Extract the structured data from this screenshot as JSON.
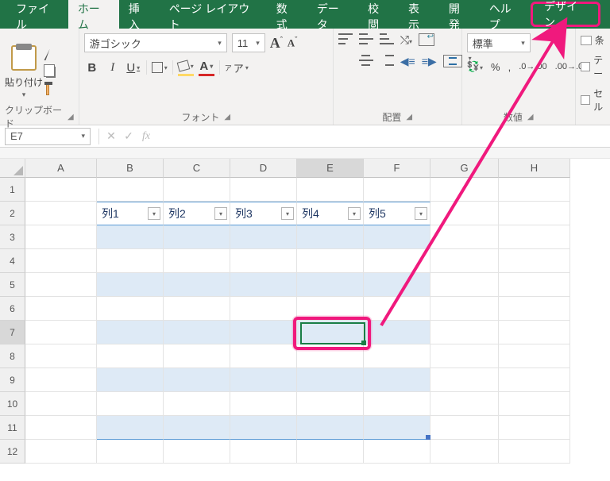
{
  "tabs": {
    "file": "ファイル",
    "home": "ホーム",
    "insert": "挿入",
    "layout": "ページ レイアウト",
    "formulas": "数式",
    "data": "データ",
    "review": "校閲",
    "view": "表示",
    "developer": "開発",
    "help": "ヘルプ",
    "design": "デザイン"
  },
  "ribbon": {
    "clipboard": {
      "paste": "貼り付け",
      "label": "クリップボード"
    },
    "font": {
      "name": "游ゴシック",
      "size": "11",
      "label": "フォント",
      "bold": "B",
      "italic": "I",
      "underline": "U",
      "fontcolor": "A",
      "phonetic": "ア"
    },
    "alignment": {
      "label": "配置"
    },
    "number": {
      "format": "標準",
      "label": "数値"
    },
    "stubs": {
      "cond": "条",
      "table": "テー",
      "cell": "セル"
    }
  },
  "formula_bar": {
    "name": "E7",
    "fx": "fx",
    "value": ""
  },
  "grid": {
    "cols": [
      "A",
      "B",
      "C",
      "D",
      "E",
      "F",
      "G",
      "H"
    ],
    "rows": [
      "1",
      "2",
      "3",
      "4",
      "5",
      "6",
      "7",
      "8",
      "9",
      "10",
      "11",
      "12"
    ],
    "table_headers": {
      "B": "列1",
      "C": "列2",
      "D": "列3",
      "E": "列4",
      "F": "列5"
    },
    "active": "E7"
  }
}
